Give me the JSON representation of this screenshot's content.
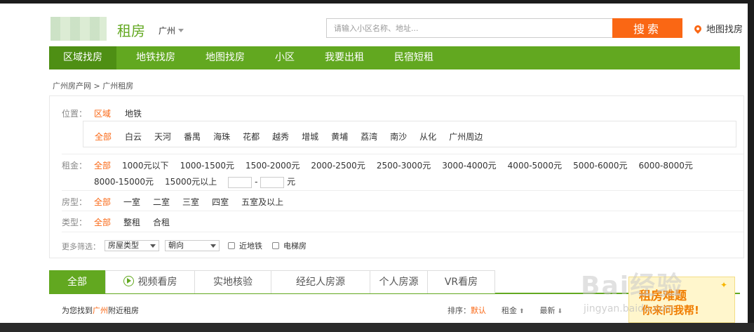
{
  "header": {
    "brand": "租房",
    "city": "广州",
    "search_placeholder": "请输入小区名称、地址...",
    "search_button": "搜索",
    "map_link": "地图找房"
  },
  "nav": {
    "items": [
      "区域找房",
      "地铁找房",
      "地图找房",
      "小区",
      "我要出租",
      "民宿短租"
    ],
    "active": "区域找房"
  },
  "breadcrumb": {
    "home": "广州房产网",
    "separator": ">",
    "current": "广州租房"
  },
  "filters": {
    "location": {
      "label": "位置：",
      "modes": [
        "区域",
        "地铁"
      ],
      "districts": [
        "全部",
        "白云",
        "天河",
        "番禺",
        "海珠",
        "花都",
        "越秀",
        "增城",
        "黄埔",
        "荔湾",
        "南沙",
        "从化",
        "广州周边"
      ]
    },
    "rent": {
      "label": "租金：",
      "options": [
        "全部",
        "1000元以下",
        "1000-1500元",
        "1500-2000元",
        "2000-2500元",
        "2500-3000元",
        "3000-4000元",
        "4000-5000元",
        "5000-6000元",
        "6000-8000元",
        "8000-15000元",
        "15000元以上"
      ],
      "range_dash": "-",
      "unit": "元"
    },
    "room_type": {
      "label": "房型：",
      "options": [
        "全部",
        "一室",
        "二室",
        "三室",
        "四室",
        "五室及以上"
      ]
    },
    "rent_type": {
      "label": "类型：",
      "options": [
        "全部",
        "整租",
        "合租"
      ]
    },
    "more": {
      "label": "更多筛选：",
      "house_type": "房屋类型",
      "orientation": "朝向",
      "near_subway": "近地铁",
      "elevator": "电梯房"
    }
  },
  "tabs": {
    "items": [
      "全部",
      "视频看房",
      "实地核验",
      "经纪人房源",
      "个人房源",
      "VR看房"
    ],
    "active": "全部"
  },
  "results": {
    "prefix": "为您找到",
    "city": "广州",
    "suffix": "附近租房"
  },
  "sort": {
    "label": "排序：",
    "default": "默认",
    "rent": "租金",
    "latest": "最新",
    "arrow": "⬆",
    "arrow_down": "⬇"
  },
  "ad": {
    "line1": "租房难题",
    "line2": "你来问我帮!",
    "star": "✦"
  },
  "watermark": {
    "text": "Bai经验",
    "sub": "jingyan.baidu.com"
  },
  "colors": {
    "primary": "#62a820",
    "accent": "#fa6714"
  }
}
